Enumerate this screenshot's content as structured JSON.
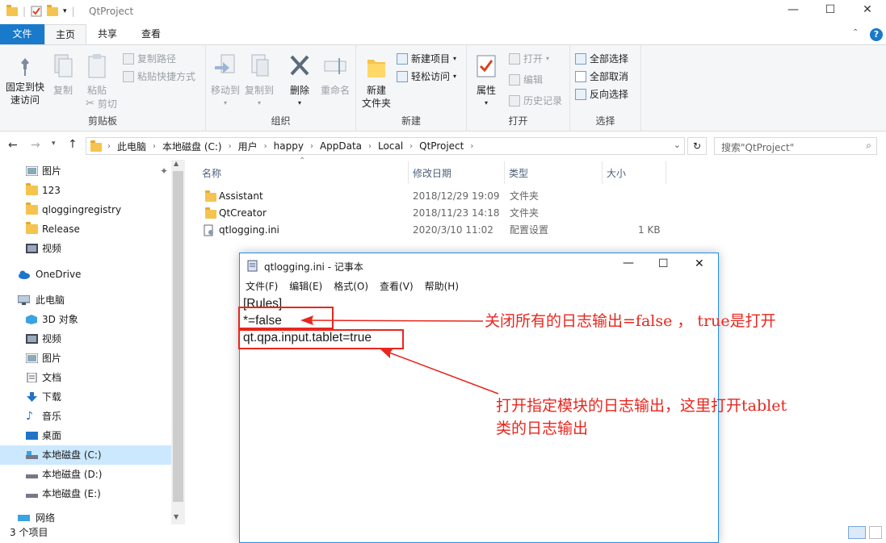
{
  "window": {
    "title": "QtProject",
    "min": "—",
    "max": "☐",
    "close": "✕"
  },
  "ribbon_tabs": [
    "文件",
    "主页",
    "共享",
    "查看"
  ],
  "ribbon": {
    "clipboard": {
      "label": "剪贴板",
      "pin": [
        "固定到快",
        "速访问"
      ],
      "copy": "复制",
      "paste": "粘贴",
      "copy_path": "复制路径",
      "paste_shortcut": "粘贴快捷方式",
      "cut": "剪切"
    },
    "organize": {
      "label": "组织",
      "move_to": "移动到",
      "copy_to": "复制到",
      "delete": "删除",
      "rename": "重命名"
    },
    "new": {
      "label": "新建",
      "new_folder": [
        "新建",
        "文件夹"
      ],
      "new_item": "新建项目",
      "easy_access": "轻松访问"
    },
    "open": {
      "label": "打开",
      "properties": "属性",
      "open": "打开",
      "edit": "编辑",
      "history": "历史记录"
    },
    "select": {
      "label": "选择",
      "select_all": "全部选择",
      "select_none": "全部取消",
      "invert": "反向选择"
    }
  },
  "address": {
    "crumbs": [
      "此电脑",
      "本地磁盘 (C:)",
      "用户",
      "happy",
      "AppData",
      "Local",
      "QtProject"
    ],
    "search_placeholder": "搜索\"QtProject\""
  },
  "nav": [
    "图片",
    "123",
    "qloggingregistry",
    "Release",
    "视频",
    "OneDrive",
    "此电脑",
    "3D 对象",
    "视频",
    "图片",
    "文档",
    "下载",
    "音乐",
    "桌面",
    "本地磁盘 (C:)",
    "本地磁盘 (D:)",
    "本地磁盘 (E:)",
    "网络"
  ],
  "columns": [
    "名称",
    "修改日期",
    "类型",
    "大小"
  ],
  "files": [
    {
      "name": "Assistant",
      "date": "2018/12/29 19:09",
      "type": "文件夹",
      "size": ""
    },
    {
      "name": "QtCreator",
      "date": "2018/11/23 14:18",
      "type": "文件夹",
      "size": ""
    },
    {
      "name": "qtlogging.ini",
      "date": "2020/3/10 11:02",
      "type": "配置设置",
      "size": "1 KB"
    }
  ],
  "status": "3 个项目",
  "notepad": {
    "title": "qtlogging.ini - 记事本",
    "menu": [
      "文件(F)",
      "编辑(E)",
      "格式(O)",
      "查看(V)",
      "帮助(H)"
    ],
    "lines": [
      "[Rules]",
      "*=false",
      "qt.qpa.input.tablet=true"
    ]
  },
  "annotations": {
    "a1": "关闭所有的日志输出=false ， true是打开",
    "a2": "打开指定模块的日志输出，这里打开tablet",
    "a3": "类的日志输出"
  },
  "colors": {
    "accent": "#1979ca",
    "annotation": "#e8261d",
    "selected": "#cce8ff"
  }
}
